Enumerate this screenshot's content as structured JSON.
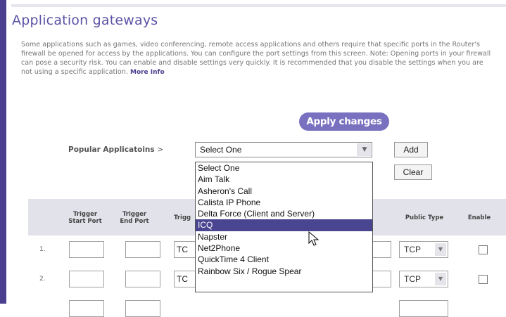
{
  "page": {
    "title": "Application gateways",
    "description": "Some applications such as games, video conferencing, remote access applications and others require that specific ports in the Router's firewall be opened for access by the applications. You can configure the port settings from this screen. Note: Opening ports in your firewall can pose a security risk. You can enable and disable settings very quickly. It is recommended that you disable the settings when you are not using a specific application.",
    "more_info": "More Info",
    "apply_label": "Apply changes"
  },
  "popular": {
    "label": "Popular Applicatoins",
    "arrow": ">",
    "selected": "Select One",
    "add_label": "Add",
    "clear_label": "Clear"
  },
  "dropdown": {
    "options": [
      "Select One",
      "Aim Talk",
      "Asheron's Call",
      "Calista IP Phone",
      "Delta Force (Client and Server)",
      "ICQ",
      "Napster",
      "Net2Phone",
      "QuickTime 4 Client",
      "Rainbow Six / Rogue Spear"
    ],
    "highlighted": "ICQ"
  },
  "table": {
    "headers": {
      "trigger_start": "Trigger Start Port",
      "trigger_end": "Trigger End Port",
      "trigger_type": "Trigg",
      "public_type": "Public Type",
      "enable": "Enable"
    },
    "rows": [
      {
        "num": "1.",
        "trigger_type": "TC",
        "public_type": "TCP",
        "enabled": false
      },
      {
        "num": "2.",
        "trigger_type": "TC",
        "public_type": "TCP",
        "enabled": false
      }
    ]
  },
  "colors": {
    "accent": "#4a3f8f",
    "title": "#5a52a5",
    "apply_button": "#7a70c0",
    "highlight": "#4a4590",
    "header_bg": "#e2e2ea"
  }
}
